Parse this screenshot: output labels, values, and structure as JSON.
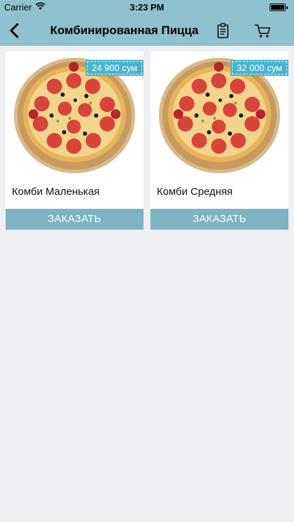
{
  "status_bar": {
    "carrier": "Carrier",
    "time": "3:23 PM"
  },
  "nav": {
    "title": "Комбинированная Пицца",
    "back_icon": "chevron-left-icon",
    "orders_icon": "clipboard-icon",
    "cart_icon": "cart-icon"
  },
  "colors": {
    "header_bg": "#8fc1ce",
    "page_bg": "#efeff4",
    "price_tag_bg": "#49b3cd",
    "order_button_bg": "#7fb3c2"
  },
  "products": [
    {
      "name": "Комби Маленькая",
      "price": "24 900 сум",
      "button": "ЗАКАЗАТЬ"
    },
    {
      "name": "Комби Средняя",
      "price": "32 000 сум",
      "button": "ЗАКАЗАТЬ"
    }
  ]
}
